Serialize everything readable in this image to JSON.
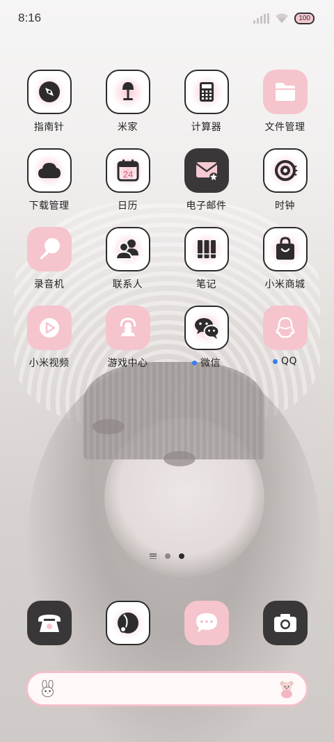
{
  "status_bar": {
    "time": "8:16",
    "battery": "100",
    "signal_icon": "cellular-signal-icon",
    "wifi_icon": "wifi-icon"
  },
  "home": {
    "rows": [
      [
        {
          "label": "指南针",
          "icon": "compass-icon",
          "style": "light"
        },
        {
          "label": "米家",
          "icon": "mijia-lamp-icon",
          "style": "light"
        },
        {
          "label": "计算器",
          "icon": "calculator-icon",
          "style": "light"
        },
        {
          "label": "文件管理",
          "icon": "folder-icon",
          "style": "pink"
        }
      ],
      [
        {
          "label": "下载管理",
          "icon": "cloud-download-icon",
          "style": "light"
        },
        {
          "label": "日历",
          "icon": "calendar-icon",
          "style": "light",
          "day": "24"
        },
        {
          "label": "电子邮件",
          "icon": "mail-icon",
          "style": "dark"
        },
        {
          "label": "时钟",
          "icon": "clock-icon",
          "style": "light"
        }
      ],
      [
        {
          "label": "录音机",
          "icon": "microphone-icon",
          "style": "pink"
        },
        {
          "label": "联系人",
          "icon": "contacts-icon",
          "style": "light"
        },
        {
          "label": "笔记",
          "icon": "notes-icon",
          "style": "light"
        },
        {
          "label": "小米商城",
          "icon": "shopping-bag-icon",
          "style": "light"
        }
      ],
      [
        {
          "label": "小米视频",
          "icon": "video-play-icon",
          "style": "pink"
        },
        {
          "label": "游戏中心",
          "icon": "game-center-icon",
          "style": "pink"
        },
        {
          "label": "微信",
          "icon": "wechat-icon",
          "style": "light",
          "new": true
        },
        {
          "label": "QQ",
          "icon": "qq-penguin-icon",
          "style": "pink",
          "new": true
        }
      ]
    ]
  },
  "pager": {
    "pages": 2,
    "current": 2
  },
  "dock": [
    {
      "icon": "phone-icon",
      "style": "dark"
    },
    {
      "icon": "browser-icon",
      "style": "light"
    },
    {
      "icon": "messages-icon",
      "style": "pink"
    },
    {
      "icon": "camera-icon",
      "style": "dark"
    }
  ],
  "search_bar": {
    "left_icon": "bunny-icon",
    "right_icon": "teddy-bear-icon"
  },
  "colors": {
    "accent_pink": "#f5c4cd",
    "dark_tile": "#3a3738",
    "new_dot": "#3a7ef0"
  }
}
